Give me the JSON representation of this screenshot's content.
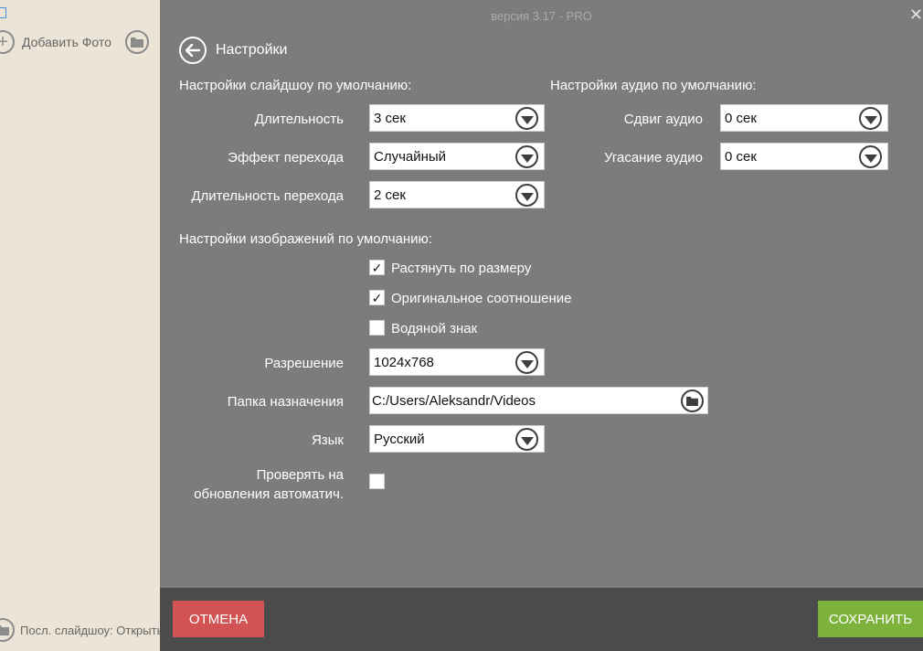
{
  "background_app": {
    "add_photo_label": "Добавить Фото",
    "recent_label": "Посл. слайдшоу: Открыть"
  },
  "panel": {
    "version": "версия 3.17 - PRO",
    "title": "Настройки",
    "slideshow_section": {
      "title": "Настройки слайдшоу по умолчанию:",
      "duration_label": "Длительность",
      "duration_value": "3 сек",
      "transition_label": "Эффект перехода",
      "transition_value": "Случайный",
      "transition_duration_label": "Длительность перехода",
      "transition_duration_value": "2 сек"
    },
    "audio_section": {
      "title": "Настройки аудио по умолчанию:",
      "shift_label": "Сдвиг аудио",
      "shift_value": "0 сек",
      "fade_label": "Угасание аудио",
      "fade_value": "0 сек"
    },
    "image_section": {
      "title": "Настройки изображений по умолчанию:",
      "stretch_label": "Растянуть по размеру",
      "stretch_checked": true,
      "ratio_label": "Оригинальное соотношение",
      "ratio_checked": true,
      "watermark_label": "Водяной знак",
      "watermark_checked": false
    },
    "resolution_label": "Разрешение",
    "resolution_value": "1024x768",
    "destination_label": "Папка назначения",
    "destination_value": "C:/Users/Aleksandr/Videos",
    "language_label": "Язык",
    "language_value": "Русский",
    "update_label_line1": "Проверять на",
    "update_label_line2": "обновления автоматич.",
    "update_checked": false
  },
  "footer": {
    "cancel_label": "ОТМЕНА",
    "save_label": "СОХРАНИТЬ"
  },
  "colors": {
    "panel_bg": "#7c7c7c",
    "footer_bg": "#4b4b4b",
    "cancel": "#d15353",
    "save": "#7db33c"
  },
  "icons": [
    "plus-icon",
    "folder-icon",
    "back-arrow-icon",
    "chevron-down-icon",
    "check-icon",
    "close-icon"
  ]
}
